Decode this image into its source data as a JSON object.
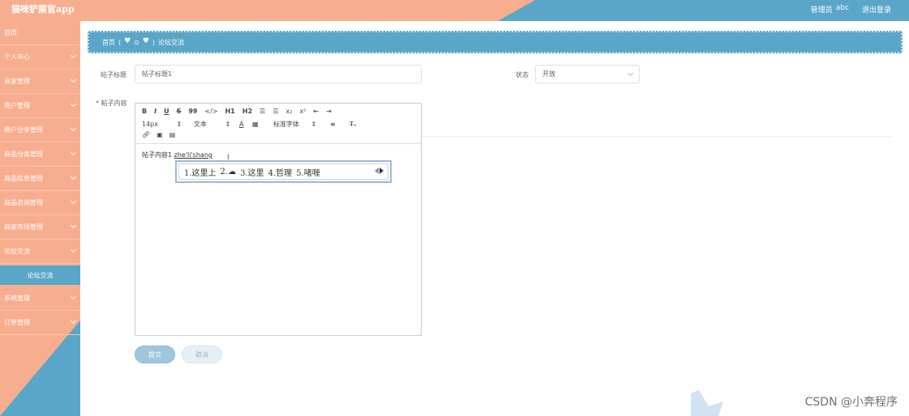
{
  "header": {
    "app_title": "猫咪铲屎官app",
    "user_role": "管理员",
    "username": "abc",
    "logout": "退出登录"
  },
  "sidebar": {
    "items": [
      {
        "label": "首页",
        "has_chevron": false
      },
      {
        "label": "个人中心",
        "has_chevron": true
      },
      {
        "label": "商家管理",
        "has_chevron": true
      },
      {
        "label": "用户管理",
        "has_chevron": true
      },
      {
        "label": "用户分享管理",
        "has_chevron": true
      },
      {
        "label": "商品分类管理",
        "has_chevron": true
      },
      {
        "label": "商品信息管理",
        "has_chevron": true
      },
      {
        "label": "商品咨询管理",
        "has_chevron": true
      },
      {
        "label": "商家市场管理",
        "has_chevron": true
      },
      {
        "label": "论坛交流",
        "has_chevron": true
      }
    ],
    "active_sub": "论坛交流",
    "items_after": [
      {
        "label": "系统管理",
        "has_chevron": true
      },
      {
        "label": "订单管理",
        "has_chevron": true
      }
    ]
  },
  "breadcrumb": {
    "home": "首页",
    "current": "论坛交流"
  },
  "form": {
    "title_label": "帖子标题",
    "title_value": "帖子标题1",
    "status_label": "状态",
    "status_value": "开放",
    "content_label": "* 帖子内容"
  },
  "editor": {
    "toolbar_row1": [
      "B",
      "I",
      "U",
      "S",
      "99",
      "</>",
      "H1",
      "H2",
      "≡",
      "≡",
      "x₂",
      "x²",
      "⇤",
      "⇥"
    ],
    "font_size": "14px",
    "text_type": "文本",
    "font_family": "标准字体",
    "content_text": "帖子内容1",
    "typing_text": "zhe'li'shang"
  },
  "ime": {
    "candidates": [
      "1.这里上",
      "2.☁",
      "3.这里",
      "4.哲理",
      "5.啫喱"
    ]
  },
  "buttons": {
    "submit": "提交",
    "cancel": "取消"
  },
  "watermark": {
    "text": "CSDN @小奔程序"
  },
  "colors": {
    "salmon": "#f7ae8f",
    "blue": "#5aa6c9"
  }
}
